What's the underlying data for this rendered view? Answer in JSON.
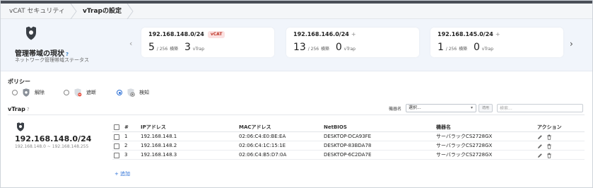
{
  "breadcrumb": [
    "vCAT セキュリティ",
    "vTrapの設定"
  ],
  "status": {
    "title": "管理帯域の現状",
    "help": "?",
    "subtitle": "ネットワーク管理帯域ステータス",
    "prev_arrow": "‹",
    "next_arrow": "›",
    "cards": [
      {
        "subnet": "192.168.148.0/24",
        "badge": "vCAT",
        "plus": "",
        "count": "5",
        "total": "/ 256",
        "total_label": "横築",
        "vtrap": "3",
        "vtrap_label": "vTrap"
      },
      {
        "subnet": "192.168.146.0/24",
        "badge": "",
        "plus": "+",
        "count": "13",
        "total": "/ 256",
        "total_label": "横築",
        "vtrap": "0",
        "vtrap_label": "vTrap"
      },
      {
        "subnet": "192.168.145.0/24",
        "badge": "",
        "plus": "+",
        "count": "1",
        "total": "/ 256",
        "total_label": "横築",
        "vtrap": "0",
        "vtrap_label": "vTrap"
      }
    ]
  },
  "policy": {
    "title": "ポリシー",
    "options": [
      {
        "label": "解除",
        "selected": false
      },
      {
        "label": "遮断",
        "selected": false
      },
      {
        "label": "検知",
        "selected": true
      }
    ]
  },
  "vtrap": {
    "title": "vTrap",
    "help": "?",
    "filter_label": "機器名",
    "filter_value": "選択...",
    "apply_label": "適用",
    "search_placeholder": "検索...",
    "network": {
      "cidr": "192.168.148.0/24",
      "range": "192.168.148.0 ~ 192.168.148.255"
    },
    "columns": {
      "num": "#",
      "ip": "IPアドレス",
      "mac": "MACアドレス",
      "netbios": "NetBIOS",
      "device": "機器名",
      "action": "アクション"
    },
    "rows": [
      {
        "num": "1",
        "ip": "192.168.148.1",
        "mac": "02:06:C4:E0:BE:EA",
        "netbios": "DESKTOP-DCA93FE",
        "device": "サーバラックCS2728GX"
      },
      {
        "num": "2",
        "ip": "192.168.148.2",
        "mac": "02:06:C4:1C:15:1E",
        "netbios": "DESKTOP-83BDA78",
        "device": "サーバラックCS2728GX"
      },
      {
        "num": "3",
        "ip": "192.168.148.3",
        "mac": "02:06:C4:B5:D7:0A",
        "netbios": "DESKTOP-6C2DA7E",
        "device": "サーバラックCS2728GX"
      }
    ],
    "add_label": "+ 追加"
  },
  "colors": {
    "accent": "#2a6fd6",
    "badge_bg": "#fbe1e1",
    "badge_text": "#c0392b",
    "band_bg": "#f1f5fb"
  }
}
